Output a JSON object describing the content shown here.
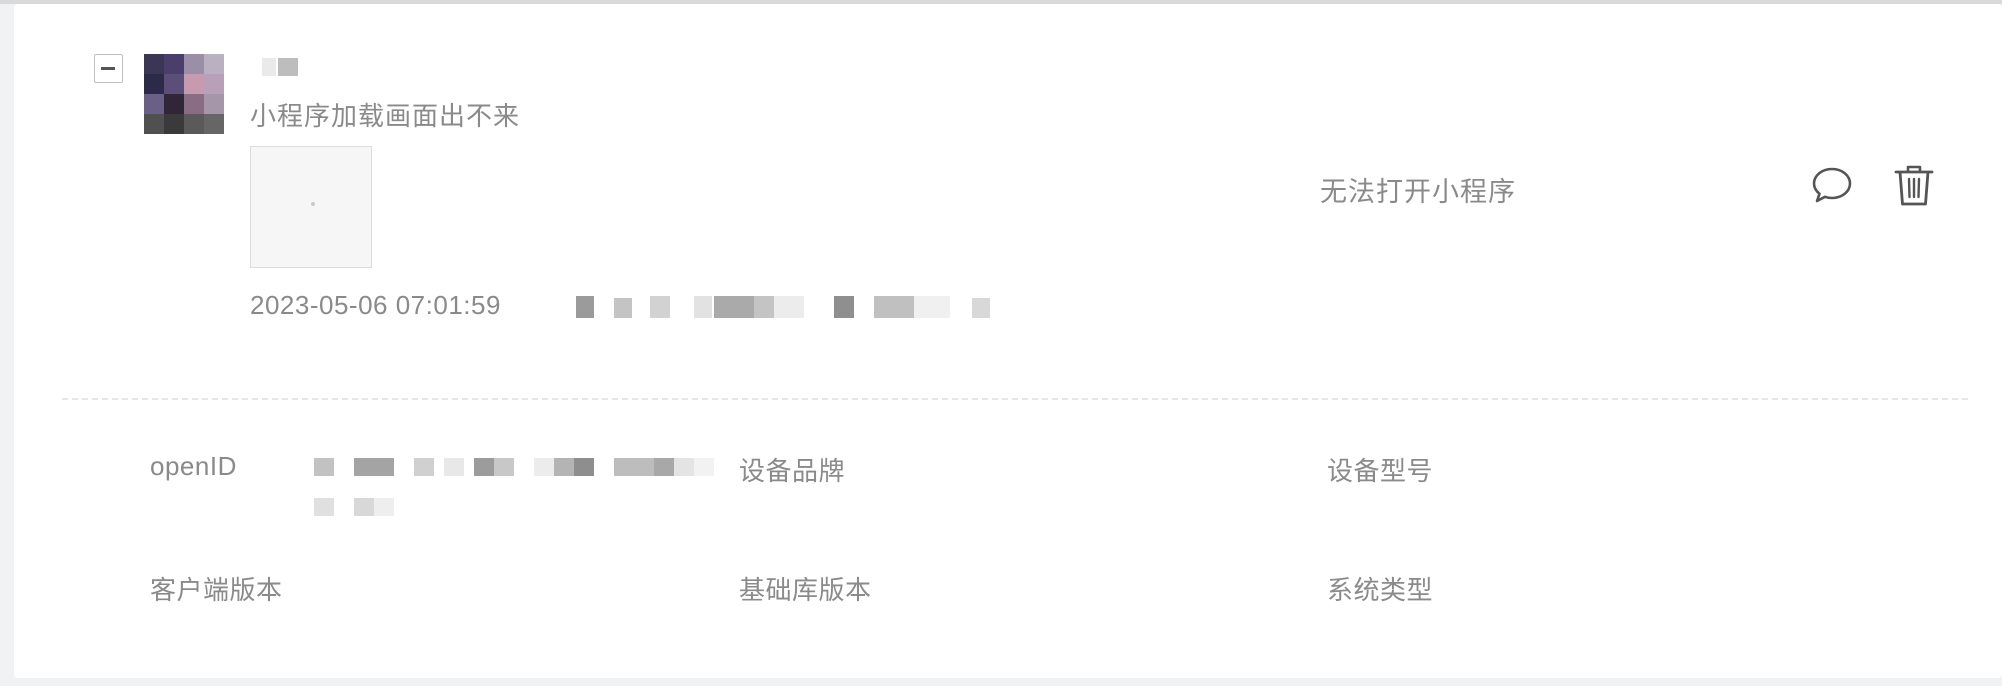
{
  "feedback": {
    "content": "小程序加载画面出不来",
    "timestamp": "2023-05-06 07:01:59",
    "category": "无法打开小程序"
  },
  "actions": {
    "reply_icon": "chat-bubble-icon",
    "delete_icon": "trash-icon"
  },
  "details": {
    "openid_label": "openID",
    "device_brand_label": "设备品牌",
    "device_model_label": "设备型号",
    "client_version_label": "客户端版本",
    "base_library_version_label": "基础库版本",
    "system_type_label": "系统类型"
  },
  "colors": {
    "text_secondary": "#8a8a8a",
    "card_background": "#ffffff",
    "page_background": "#f1f2f4",
    "divider": "#e6e6e6"
  }
}
